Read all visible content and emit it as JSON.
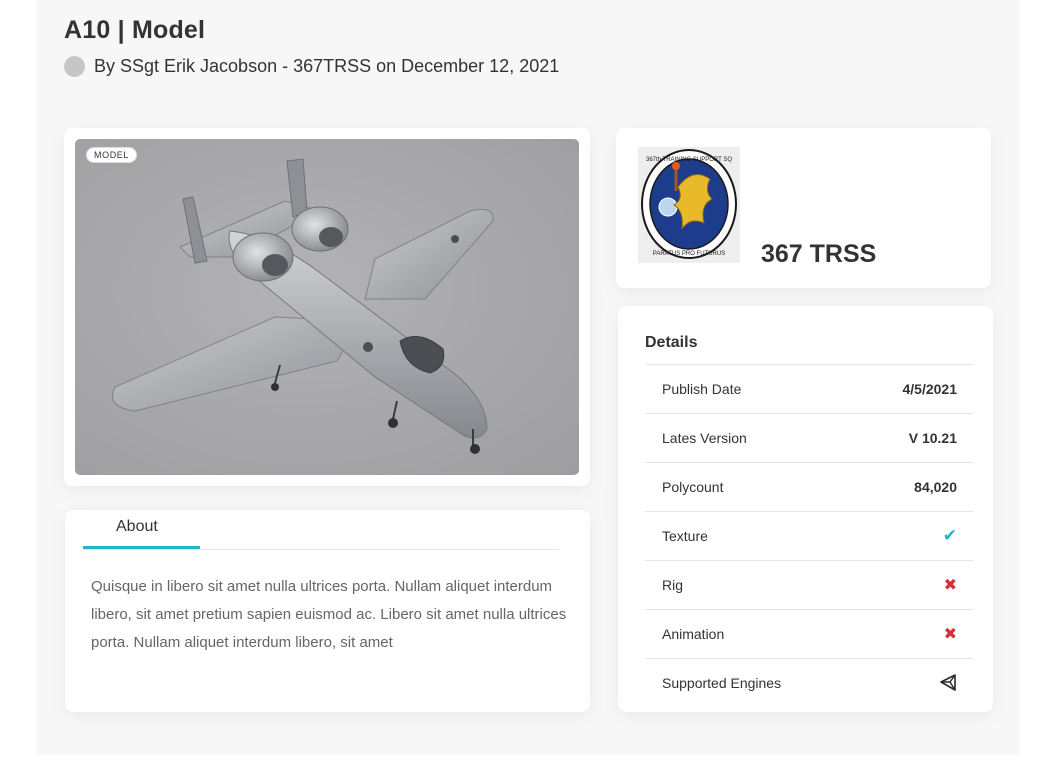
{
  "header": {
    "title": "A10 | Model",
    "byline": "By SSgt Erik Jacobson - 367TRSS on December 12, 2021"
  },
  "viewer": {
    "badge": "MODEL"
  },
  "about": {
    "tab_label": "About",
    "text": "Quisque in libero sit amet nulla ultrices porta. Nullam aliquet interdum libero, sit amet pretium sapien euismod ac. Libero sit amet nulla ultrices porta. Nullam aliquet interdum libero, sit amet"
  },
  "org": {
    "name": "367 TRSS",
    "emblem_top_text": "367th TRAINING SUPPORT SQ",
    "emblem_bottom_text": "PARATUS PRO FUTURUS"
  },
  "details": {
    "title": "Details",
    "rows": [
      {
        "label": "Publish Date",
        "value": "4/5/2021"
      },
      {
        "label": "Lates Version",
        "value": "V 10.21"
      },
      {
        "label": "Polycount",
        "value": "84,020"
      },
      {
        "label": "Texture",
        "value": "✔"
      },
      {
        "label": "Rig",
        "value": "✖"
      },
      {
        "label": "Animation",
        "value": "✖"
      },
      {
        "label": "Supported Engines",
        "value": ""
      }
    ]
  },
  "colors": {
    "accent": "#1fb6c9",
    "negative": "#d32f3a",
    "page_bg": "#f7f7f7"
  },
  "icons": {
    "texture": "check-icon",
    "rig": "cross-icon",
    "animation": "cross-icon",
    "engine": "unity-engine-icon",
    "author": "avatar"
  }
}
